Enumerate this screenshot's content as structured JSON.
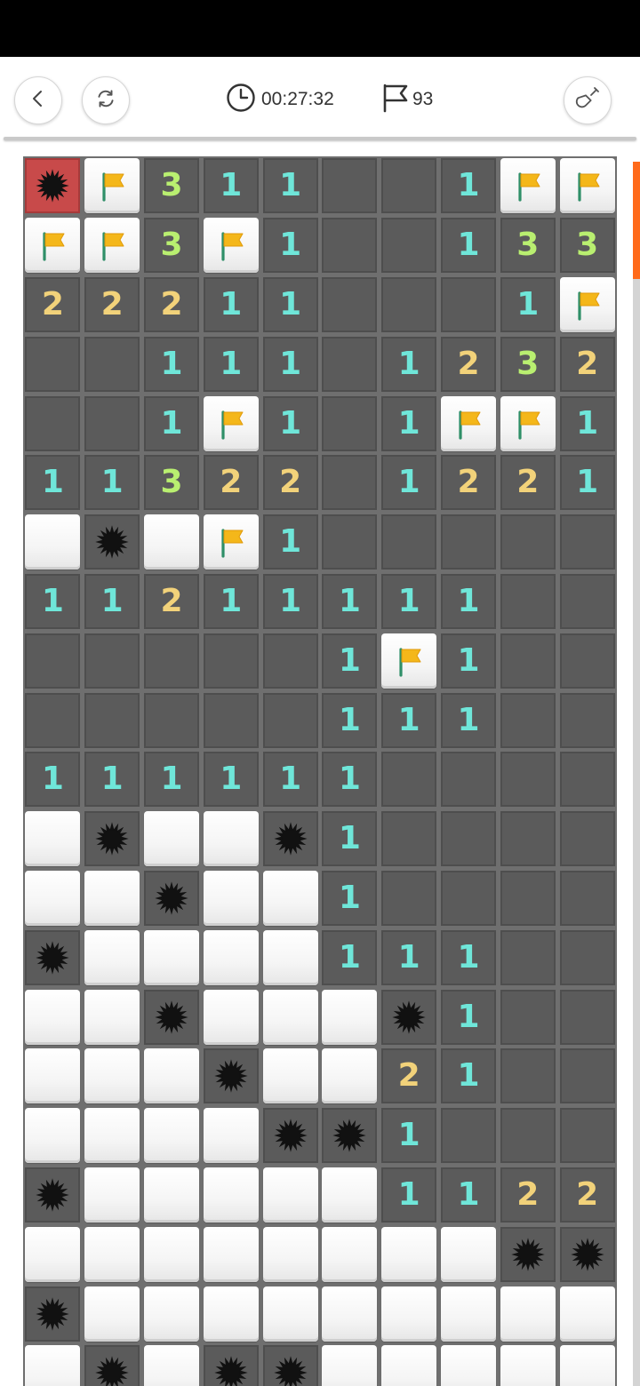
{
  "header": {
    "timer": "00:27:32",
    "flag_count": "93",
    "back_icon": "chevron-left-icon",
    "restart_icon": "refresh-icon",
    "shovel_icon": "shovel-icon"
  },
  "colors": {
    "num1": "#6fe6d9",
    "num2": "#f2d27a",
    "num3": "#b9ef70",
    "exploded": "#c84a4a",
    "scroll_thumb": "#ff6a1a"
  },
  "board": {
    "columns": 10,
    "legend": "R=revealed empty, C=covered, F=flag, M=mine, X=exploded mine, digit=adjacent mine count",
    "rows": [
      [
        "X",
        "F",
        "3",
        "1",
        "1",
        "R",
        "R",
        "1",
        "F",
        "F"
      ],
      [
        "F",
        "F",
        "3",
        "F",
        "1",
        "R",
        "R",
        "1",
        "3",
        "3"
      ],
      [
        "2",
        "2",
        "2",
        "1",
        "1",
        "R",
        "R",
        "R",
        "1",
        "F"
      ],
      [
        "R",
        "R",
        "1",
        "1",
        "1",
        "R",
        "1",
        "2",
        "3",
        "2"
      ],
      [
        "R",
        "R",
        "1",
        "F",
        "1",
        "R",
        "1",
        "F",
        "F",
        "1"
      ],
      [
        "1",
        "1",
        "3",
        "2",
        "2",
        "R",
        "1",
        "2",
        "2",
        "1"
      ],
      [
        "C",
        "M",
        "C",
        "F",
        "1",
        "R",
        "R",
        "R",
        "R",
        "R"
      ],
      [
        "1",
        "1",
        "2",
        "1",
        "1",
        "1",
        "1",
        "1",
        "R",
        "R"
      ],
      [
        "R",
        "R",
        "R",
        "R",
        "R",
        "1",
        "F",
        "1",
        "R",
        "R"
      ],
      [
        "R",
        "R",
        "R",
        "R",
        "R",
        "1",
        "1",
        "1",
        "R",
        "R"
      ],
      [
        "1",
        "1",
        "1",
        "1",
        "1",
        "1",
        "R",
        "R",
        "R",
        "R"
      ],
      [
        "C",
        "M",
        "C",
        "C",
        "M",
        "1",
        "R",
        "R",
        "R",
        "R"
      ],
      [
        "C",
        "C",
        "M",
        "C",
        "C",
        "1",
        "R",
        "R",
        "R",
        "R"
      ],
      [
        "M",
        "C",
        "C",
        "C",
        "C",
        "1",
        "1",
        "1",
        "R",
        "R"
      ],
      [
        "C",
        "C",
        "M",
        "C",
        "C",
        "C",
        "M",
        "1",
        "R",
        "R"
      ],
      [
        "C",
        "C",
        "C",
        "M",
        "C",
        "C",
        "2",
        "1",
        "R",
        "R"
      ],
      [
        "C",
        "C",
        "C",
        "C",
        "M",
        "M",
        "1",
        "R",
        "R",
        "R"
      ],
      [
        "M",
        "C",
        "C",
        "C",
        "C",
        "C",
        "1",
        "1",
        "2",
        "2"
      ],
      [
        "C",
        "C",
        "C",
        "C",
        "C",
        "C",
        "C",
        "C",
        "M",
        "M"
      ],
      [
        "M",
        "C",
        "C",
        "C",
        "C",
        "C",
        "C",
        "C",
        "C",
        "C"
      ],
      [
        "C",
        "M",
        "C",
        "M",
        "M",
        "C",
        "C",
        "C",
        "C",
        "C"
      ]
    ]
  }
}
